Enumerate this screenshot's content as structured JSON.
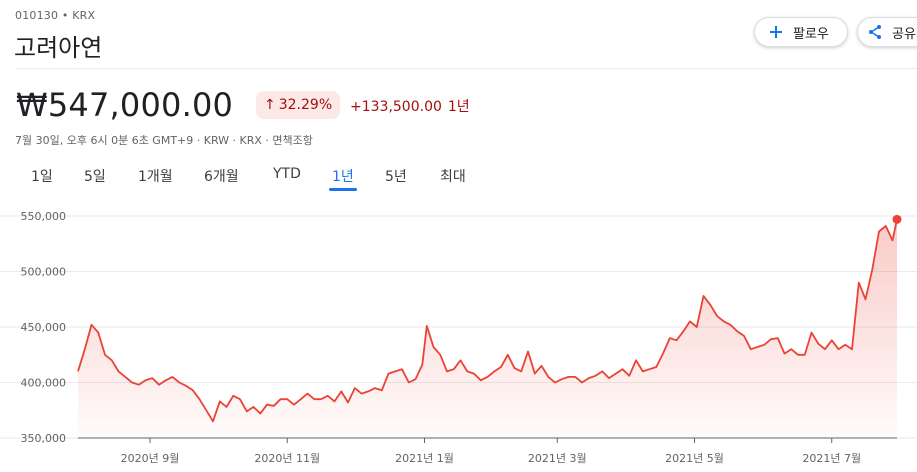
{
  "header": {
    "ticker": "010130 • KRX",
    "company": "고려아연",
    "follow_label": "팔로우",
    "share_label": "공유"
  },
  "quote": {
    "price": "₩547,000.00",
    "change_pct": "32.29%",
    "change_abs": "+133,500.00",
    "change_period": "1년",
    "meta": "7월 30일, 오후 6시 0분 6초 GMT+9 · KRW · KRX · 면책조항"
  },
  "tabs": [
    {
      "label": "1일",
      "active": false
    },
    {
      "label": "5일",
      "active": false
    },
    {
      "label": "1개월",
      "active": false
    },
    {
      "label": "6개월",
      "active": false
    },
    {
      "label": "YTD",
      "active": false
    },
    {
      "label": "1년",
      "active": true
    },
    {
      "label": "5년",
      "active": false
    },
    {
      "label": "최대",
      "active": false
    }
  ],
  "colors": {
    "line": "#ea4335",
    "positive_text": "#a50e0e",
    "positive_bg": "#fce8e6",
    "accent": "#1a73e8",
    "grid": "#e8eaed"
  },
  "chart_data": {
    "type": "area",
    "ylim": [
      350000,
      550000
    ],
    "yticks": [
      550000,
      500000,
      450000,
      400000,
      350000
    ],
    "ytick_labels": [
      "550,000",
      "500,000",
      "450,000",
      "400,000",
      "350,000"
    ],
    "xlim": [
      "2020-07-31",
      "2021-07-30"
    ],
    "xticks": [
      {
        "date": "2020-09-01",
        "label": "2020년 9월"
      },
      {
        "date": "2020-11-01",
        "label": "2020년 11월"
      },
      {
        "date": "2021-01-01",
        "label": "2021년 1월"
      },
      {
        "date": "2021-03-01",
        "label": "2021년 3월"
      },
      {
        "date": "2021-05-01",
        "label": "2021년 5월"
      },
      {
        "date": "2021-07-01",
        "label": "2021년 7월"
      }
    ],
    "series": [
      {
        "x": [
          "2020-07-31",
          "2020-08-03",
          "2020-08-06",
          "2020-08-09",
          "2020-08-12",
          "2020-08-15",
          "2020-08-18",
          "2020-08-21",
          "2020-08-24",
          "2020-08-27",
          "2020-08-30",
          "2020-09-02",
          "2020-09-05",
          "2020-09-08",
          "2020-09-11",
          "2020-09-14",
          "2020-09-17",
          "2020-09-20",
          "2020-09-23",
          "2020-09-26",
          "2020-09-29",
          "2020-10-02",
          "2020-10-05",
          "2020-10-08",
          "2020-10-11",
          "2020-10-14",
          "2020-10-17",
          "2020-10-20",
          "2020-10-23",
          "2020-10-26",
          "2020-10-29",
          "2020-11-01",
          "2020-11-04",
          "2020-11-07",
          "2020-11-10",
          "2020-11-13",
          "2020-11-16",
          "2020-11-19",
          "2020-11-22",
          "2020-11-25",
          "2020-11-28",
          "2020-12-01",
          "2020-12-04",
          "2020-12-07",
          "2020-12-10",
          "2020-12-13",
          "2020-12-16",
          "2020-12-19",
          "2020-12-22",
          "2020-12-25",
          "2020-12-28",
          "2020-12-31",
          "2021-01-02",
          "2021-01-05",
          "2021-01-08",
          "2021-01-11",
          "2021-01-14",
          "2021-01-17",
          "2021-01-20",
          "2021-01-23",
          "2021-01-26",
          "2021-01-29",
          "2021-02-01",
          "2021-02-04",
          "2021-02-07",
          "2021-02-10",
          "2021-02-13",
          "2021-02-16",
          "2021-02-19",
          "2021-02-22",
          "2021-02-25",
          "2021-02-28",
          "2021-03-03",
          "2021-03-06",
          "2021-03-09",
          "2021-03-12",
          "2021-03-15",
          "2021-03-18",
          "2021-03-21",
          "2021-03-24",
          "2021-03-27",
          "2021-03-30",
          "2021-04-02",
          "2021-04-05",
          "2021-04-08",
          "2021-04-11",
          "2021-04-14",
          "2021-04-17",
          "2021-04-20",
          "2021-04-23",
          "2021-04-26",
          "2021-04-29",
          "2021-05-02",
          "2021-05-05",
          "2021-05-08",
          "2021-05-11",
          "2021-05-14",
          "2021-05-17",
          "2021-05-20",
          "2021-05-23",
          "2021-05-26",
          "2021-05-29",
          "2021-06-01",
          "2021-06-04",
          "2021-06-07",
          "2021-06-10",
          "2021-06-13",
          "2021-06-16",
          "2021-06-19",
          "2021-06-22",
          "2021-06-25",
          "2021-06-28",
          "2021-07-01",
          "2021-07-04",
          "2021-07-07",
          "2021-07-10",
          "2021-07-13",
          "2021-07-16",
          "2021-07-19",
          "2021-07-22",
          "2021-07-25",
          "2021-07-28",
          "2021-07-30"
        ],
        "y": [
          410000,
          430000,
          452000,
          445000,
          425000,
          420000,
          410000,
          405000,
          400000,
          398000,
          402000,
          404000,
          398000,
          402000,
          405000,
          400000,
          397000,
          393000,
          385000,
          375000,
          365000,
          383000,
          378000,
          388000,
          385000,
          374000,
          378000,
          372000,
          380000,
          379000,
          385000,
          385000,
          380000,
          385000,
          390000,
          385000,
          385000,
          388000,
          383000,
          392000,
          382000,
          395000,
          390000,
          392000,
          395000,
          393000,
          408000,
          410000,
          412000,
          400000,
          403000,
          416000,
          451000,
          432000,
          425000,
          410000,
          412000,
          420000,
          410000,
          408000,
          402000,
          405000,
          410000,
          414000,
          425000,
          413000,
          410000,
          428000,
          408000,
          415000,
          405000,
          400000,
          403000,
          405000,
          405000,
          400000,
          404000,
          406000,
          410000,
          404000,
          408000,
          412000,
          406000,
          420000,
          410000,
          412000,
          414000,
          426000,
          440000,
          438000,
          446000,
          455000,
          450000,
          478000,
          470000,
          460000,
          455000,
          452000,
          446000,
          442000,
          430000,
          432000,
          434000,
          439000,
          440000,
          426000,
          430000,
          425000,
          425000,
          445000,
          435000,
          430000,
          438000,
          430000,
          434000,
          430000,
          490000,
          475000,
          502000,
          536000,
          541000,
          528000,
          547000
        ]
      }
    ]
  }
}
